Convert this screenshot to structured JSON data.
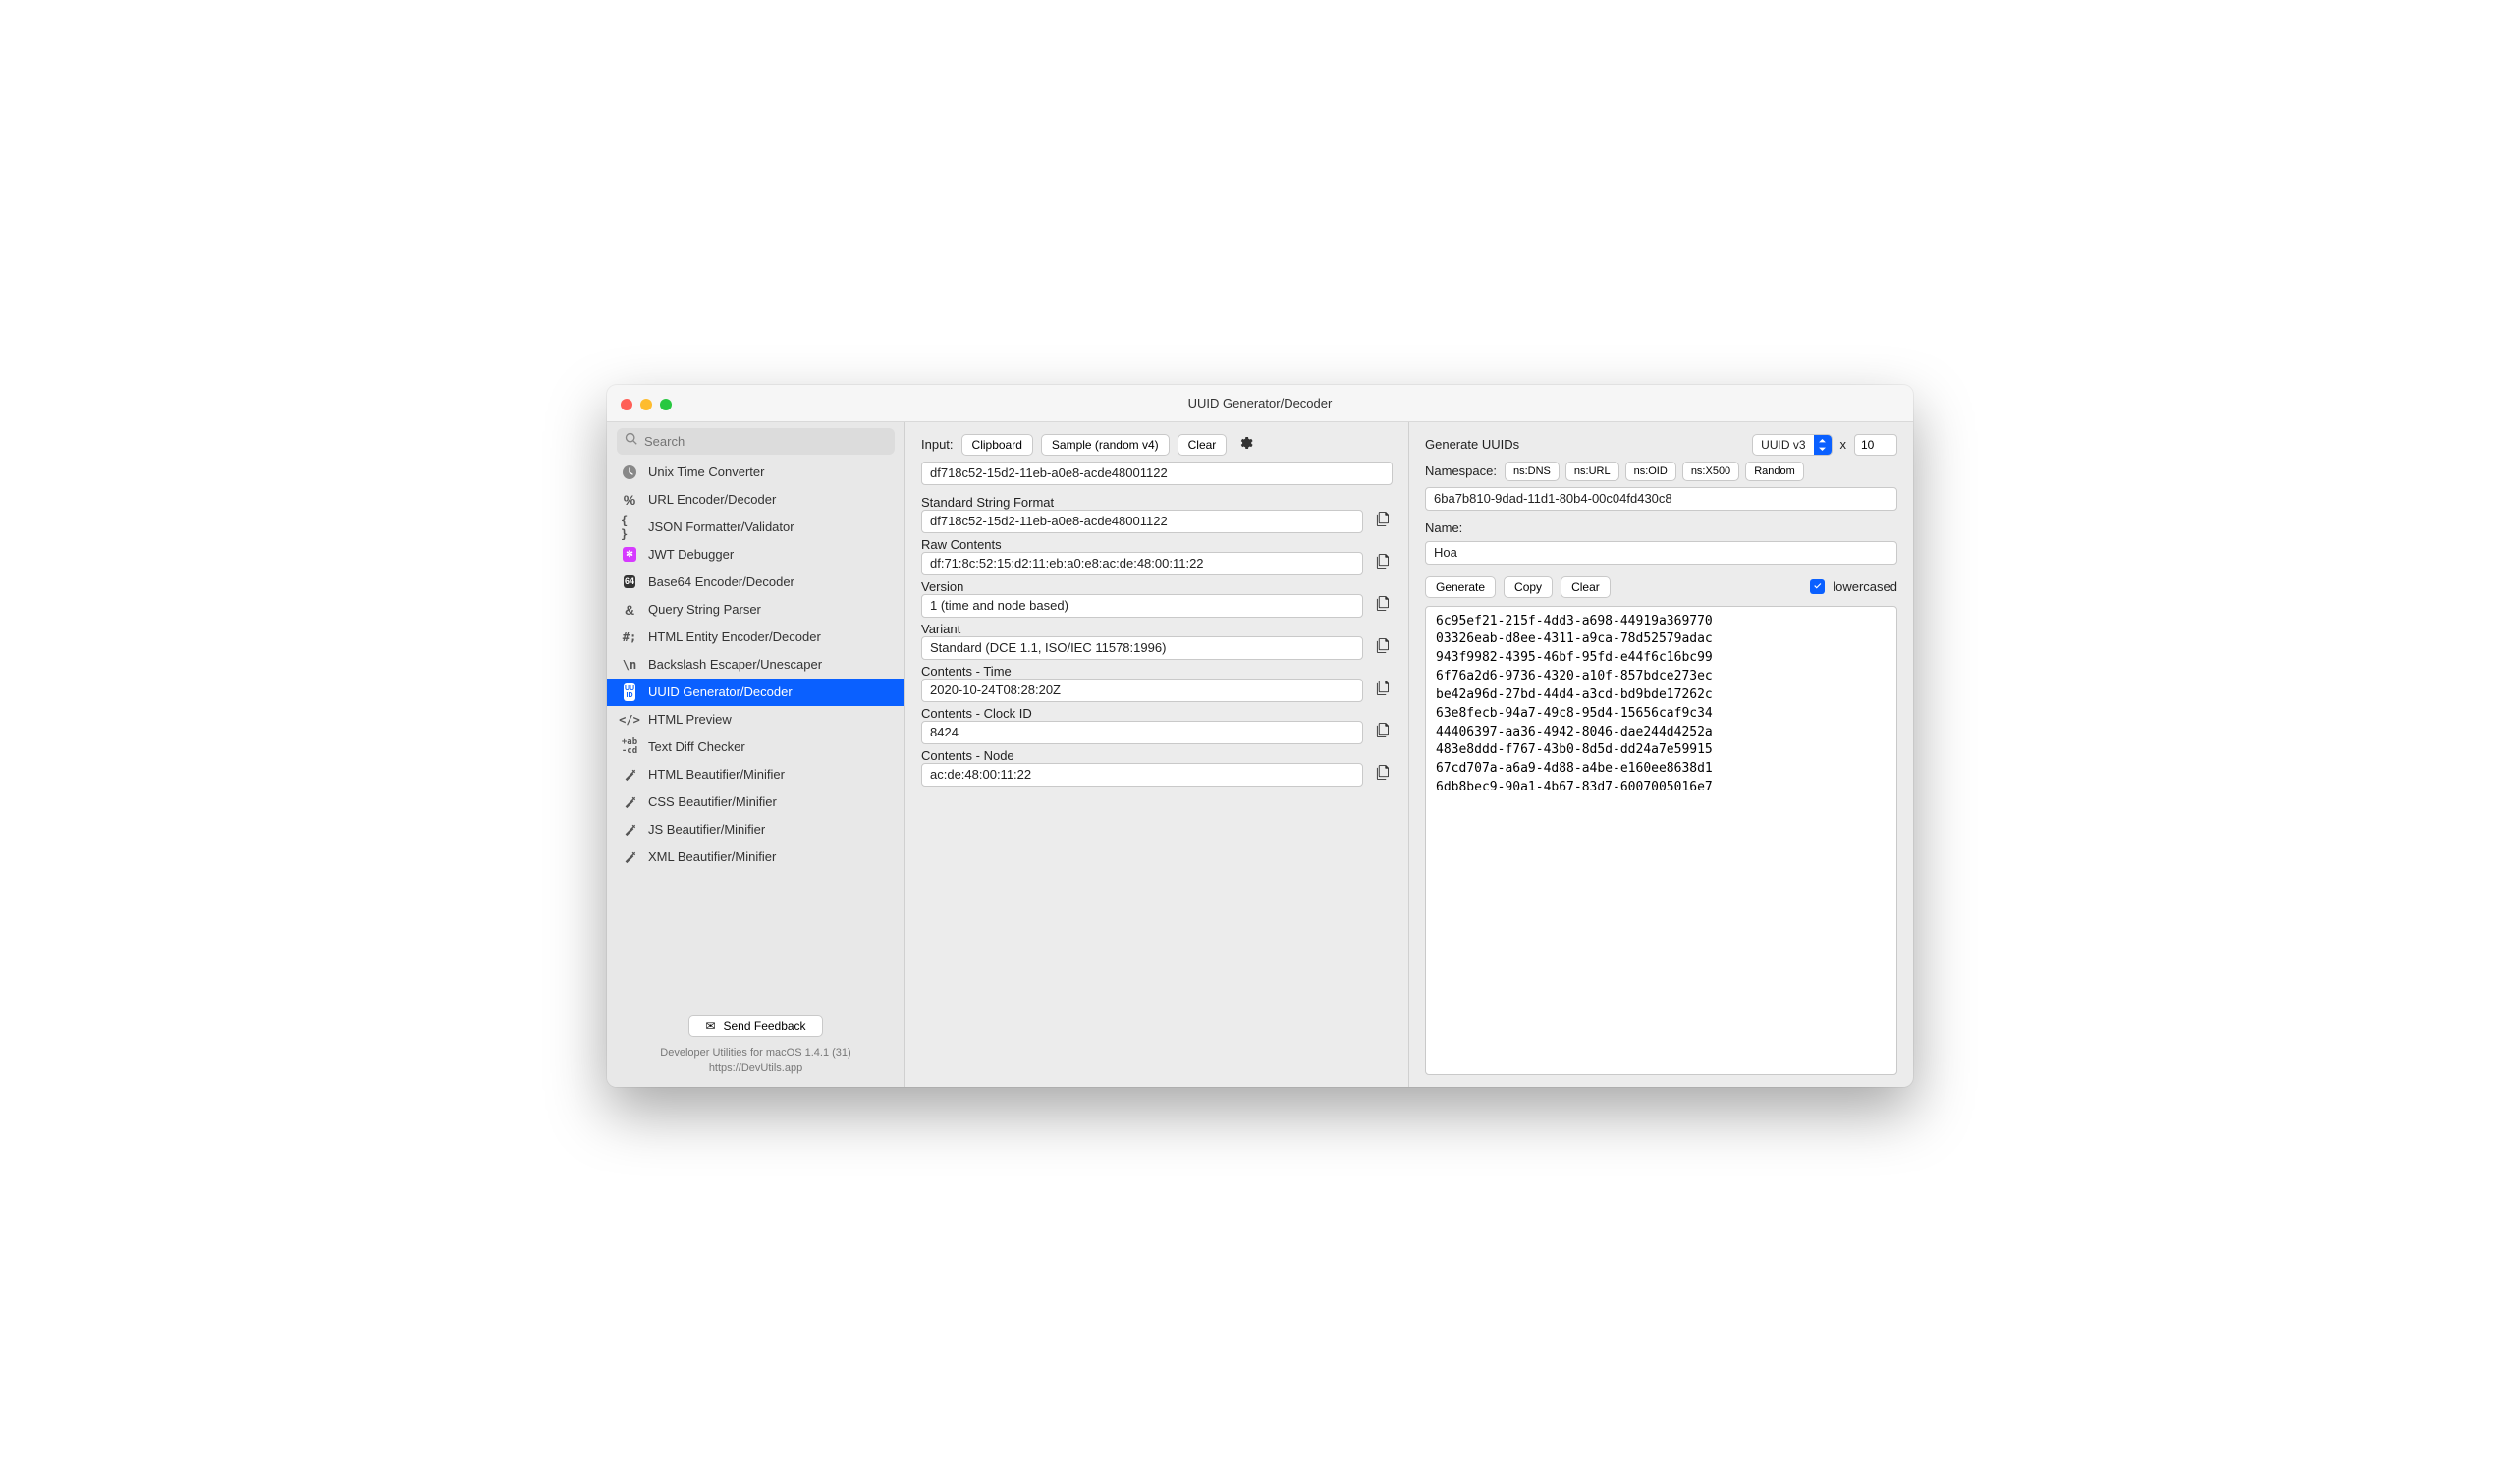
{
  "window": {
    "title": "UUID Generator/Decoder"
  },
  "search": {
    "placeholder": "Search"
  },
  "sidebar": {
    "items": [
      {
        "label": "Unix Time Converter",
        "icon": "clock"
      },
      {
        "label": "URL Encoder/Decoder",
        "icon": "percent"
      },
      {
        "label": "JSON Formatter/Validator",
        "icon": "braces"
      },
      {
        "label": "JWT Debugger",
        "icon": "jwt"
      },
      {
        "label": "Base64 Encoder/Decoder",
        "icon": "b64"
      },
      {
        "label": "Query String Parser",
        "icon": "amp"
      },
      {
        "label": "HTML Entity Encoder/Decoder",
        "icon": "hash"
      },
      {
        "label": "Backslash Escaper/Unescaper",
        "icon": "bslash"
      },
      {
        "label": "UUID Generator/Decoder",
        "icon": "uuid",
        "selected": true
      },
      {
        "label": "HTML Preview",
        "icon": "code"
      },
      {
        "label": "Text Diff Checker",
        "icon": "diff"
      },
      {
        "label": "HTML Beautifier/Minifier",
        "icon": "wand"
      },
      {
        "label": "CSS Beautifier/Minifier",
        "icon": "wand"
      },
      {
        "label": "JS Beautifier/Minifier",
        "icon": "wand"
      },
      {
        "label": "XML Beautifier/Minifier",
        "icon": "wand"
      }
    ],
    "feedback": "Send Feedback",
    "footer1": "Developer Utilities for macOS 1.4.1 (31)",
    "footer2": "https://DevUtils.app"
  },
  "decoder": {
    "input_label": "Input:",
    "clipboard_btn": "Clipboard",
    "sample_btn": "Sample (random v4)",
    "clear_btn": "Clear",
    "input_value": "df718c52-15d2-11eb-a0e8-acde48001122",
    "sections": [
      {
        "label": "Standard String Format",
        "value": "df718c52-15d2-11eb-a0e8-acde48001122"
      },
      {
        "label": "Raw Contents",
        "value": "df:71:8c:52:15:d2:11:eb:a0:e8:ac:de:48:00:11:22"
      },
      {
        "label": "Version",
        "value": "1 (time and node based)"
      },
      {
        "label": "Variant",
        "value": "Standard (DCE 1.1, ISO/IEC 11578:1996)"
      },
      {
        "label": "Contents - Time",
        "value": "2020-10-24T08:28:20Z"
      },
      {
        "label": "Contents - Clock ID",
        "value": "8424"
      },
      {
        "label": "Contents - Node",
        "value": "ac:de:48:00:11:22"
      }
    ]
  },
  "generator": {
    "title": "Generate UUIDs",
    "version_select": "UUID v3",
    "x_label": "x",
    "count": "10",
    "namespace_label": "Namespace:",
    "ns_buttons": [
      "ns:DNS",
      "ns:URL",
      "ns:OID",
      "ns:X500",
      "Random"
    ],
    "namespace_value": "6ba7b810-9dad-11d1-80b4-00c04fd430c8",
    "name_label": "Name:",
    "name_value": "Hoa",
    "generate_btn": "Generate",
    "copy_btn": "Copy",
    "clear_btn": "Clear",
    "lowercase_label": "lowercased",
    "output": "6c95ef21-215f-4dd3-a698-44919a369770\n03326eab-d8ee-4311-a9ca-78d52579adac\n943f9982-4395-46bf-95fd-e44f6c16bc99\n6f76a2d6-9736-4320-a10f-857bdce273ec\nbe42a96d-27bd-44d4-a3cd-bd9bde17262c\n63e8fecb-94a7-49c8-95d4-15656caf9c34\n44406397-aa36-4942-8046-dae244d4252a\n483e8ddd-f767-43b0-8d5d-dd24a7e59915\n67cd707a-a6a9-4d88-a4be-e160ee8638d1\n6db8bec9-90a1-4b67-83d7-6007005016e7"
  }
}
